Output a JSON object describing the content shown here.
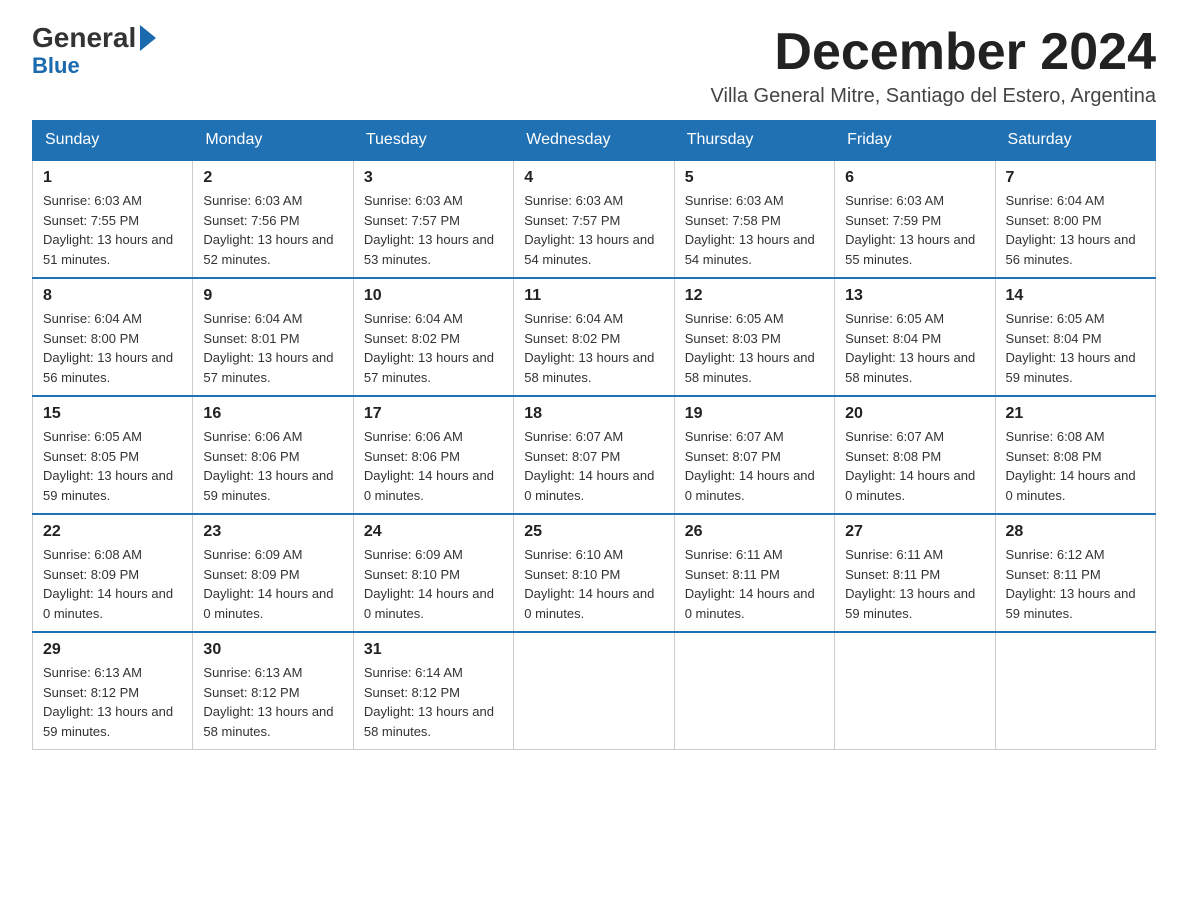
{
  "logo": {
    "general": "General",
    "blue": "Blue",
    "arrow": "▶"
  },
  "title": "December 2024",
  "location": "Villa General Mitre, Santiago del Estero, Argentina",
  "weekdays": [
    "Sunday",
    "Monday",
    "Tuesday",
    "Wednesday",
    "Thursday",
    "Friday",
    "Saturday"
  ],
  "weeks": [
    [
      {
        "day": "1",
        "sunrise": "6:03 AM",
        "sunset": "7:55 PM",
        "daylight": "13 hours and 51 minutes."
      },
      {
        "day": "2",
        "sunrise": "6:03 AM",
        "sunset": "7:56 PM",
        "daylight": "13 hours and 52 minutes."
      },
      {
        "day": "3",
        "sunrise": "6:03 AM",
        "sunset": "7:57 PM",
        "daylight": "13 hours and 53 minutes."
      },
      {
        "day": "4",
        "sunrise": "6:03 AM",
        "sunset": "7:57 PM",
        "daylight": "13 hours and 54 minutes."
      },
      {
        "day": "5",
        "sunrise": "6:03 AM",
        "sunset": "7:58 PM",
        "daylight": "13 hours and 54 minutes."
      },
      {
        "day": "6",
        "sunrise": "6:03 AM",
        "sunset": "7:59 PM",
        "daylight": "13 hours and 55 minutes."
      },
      {
        "day": "7",
        "sunrise": "6:04 AM",
        "sunset": "8:00 PM",
        "daylight": "13 hours and 56 minutes."
      }
    ],
    [
      {
        "day": "8",
        "sunrise": "6:04 AM",
        "sunset": "8:00 PM",
        "daylight": "13 hours and 56 minutes."
      },
      {
        "day": "9",
        "sunrise": "6:04 AM",
        "sunset": "8:01 PM",
        "daylight": "13 hours and 57 minutes."
      },
      {
        "day": "10",
        "sunrise": "6:04 AM",
        "sunset": "8:02 PM",
        "daylight": "13 hours and 57 minutes."
      },
      {
        "day": "11",
        "sunrise": "6:04 AM",
        "sunset": "8:02 PM",
        "daylight": "13 hours and 58 minutes."
      },
      {
        "day": "12",
        "sunrise": "6:05 AM",
        "sunset": "8:03 PM",
        "daylight": "13 hours and 58 minutes."
      },
      {
        "day": "13",
        "sunrise": "6:05 AM",
        "sunset": "8:04 PM",
        "daylight": "13 hours and 58 minutes."
      },
      {
        "day": "14",
        "sunrise": "6:05 AM",
        "sunset": "8:04 PM",
        "daylight": "13 hours and 59 minutes."
      }
    ],
    [
      {
        "day": "15",
        "sunrise": "6:05 AM",
        "sunset": "8:05 PM",
        "daylight": "13 hours and 59 minutes."
      },
      {
        "day": "16",
        "sunrise": "6:06 AM",
        "sunset": "8:06 PM",
        "daylight": "13 hours and 59 minutes."
      },
      {
        "day": "17",
        "sunrise": "6:06 AM",
        "sunset": "8:06 PM",
        "daylight": "14 hours and 0 minutes."
      },
      {
        "day": "18",
        "sunrise": "6:07 AM",
        "sunset": "8:07 PM",
        "daylight": "14 hours and 0 minutes."
      },
      {
        "day": "19",
        "sunrise": "6:07 AM",
        "sunset": "8:07 PM",
        "daylight": "14 hours and 0 minutes."
      },
      {
        "day": "20",
        "sunrise": "6:07 AM",
        "sunset": "8:08 PM",
        "daylight": "14 hours and 0 minutes."
      },
      {
        "day": "21",
        "sunrise": "6:08 AM",
        "sunset": "8:08 PM",
        "daylight": "14 hours and 0 minutes."
      }
    ],
    [
      {
        "day": "22",
        "sunrise": "6:08 AM",
        "sunset": "8:09 PM",
        "daylight": "14 hours and 0 minutes."
      },
      {
        "day": "23",
        "sunrise": "6:09 AM",
        "sunset": "8:09 PM",
        "daylight": "14 hours and 0 minutes."
      },
      {
        "day": "24",
        "sunrise": "6:09 AM",
        "sunset": "8:10 PM",
        "daylight": "14 hours and 0 minutes."
      },
      {
        "day": "25",
        "sunrise": "6:10 AM",
        "sunset": "8:10 PM",
        "daylight": "14 hours and 0 minutes."
      },
      {
        "day": "26",
        "sunrise": "6:11 AM",
        "sunset": "8:11 PM",
        "daylight": "14 hours and 0 minutes."
      },
      {
        "day": "27",
        "sunrise": "6:11 AM",
        "sunset": "8:11 PM",
        "daylight": "13 hours and 59 minutes."
      },
      {
        "day": "28",
        "sunrise": "6:12 AM",
        "sunset": "8:11 PM",
        "daylight": "13 hours and 59 minutes."
      }
    ],
    [
      {
        "day": "29",
        "sunrise": "6:13 AM",
        "sunset": "8:12 PM",
        "daylight": "13 hours and 59 minutes."
      },
      {
        "day": "30",
        "sunrise": "6:13 AM",
        "sunset": "8:12 PM",
        "daylight": "13 hours and 58 minutes."
      },
      {
        "day": "31",
        "sunrise": "6:14 AM",
        "sunset": "8:12 PM",
        "daylight": "13 hours and 58 minutes."
      },
      null,
      null,
      null,
      null
    ]
  ]
}
